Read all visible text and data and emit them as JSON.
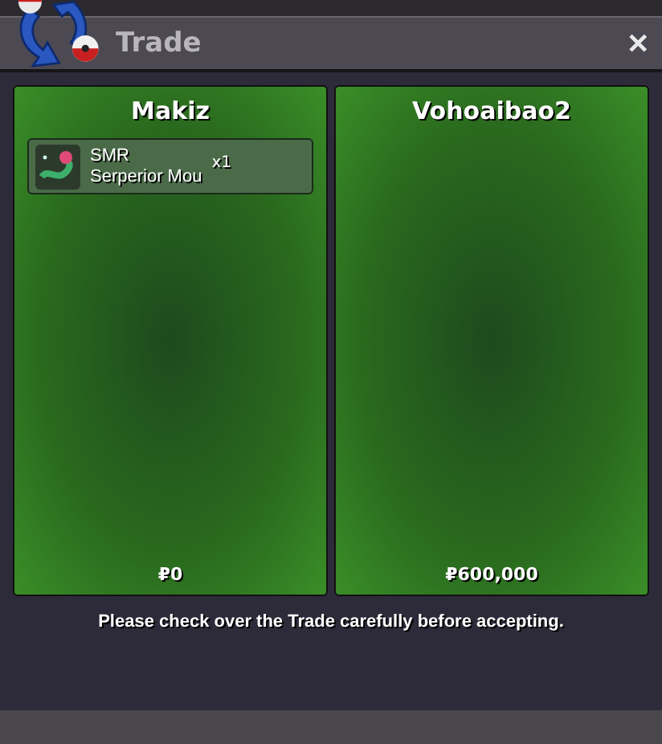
{
  "window": {
    "title": "Trade",
    "close": "✕"
  },
  "panels": [
    {
      "name": "Makiz",
      "items": [
        {
          "name": "SMR",
          "subtitle": "Serperior Mou",
          "quantity": "x1"
        }
      ],
      "money": "₽0"
    },
    {
      "name": "Vohoaibao2",
      "money": "₽600,000"
    }
  ],
  "message": "Please check over the Trade carefully before accepting."
}
